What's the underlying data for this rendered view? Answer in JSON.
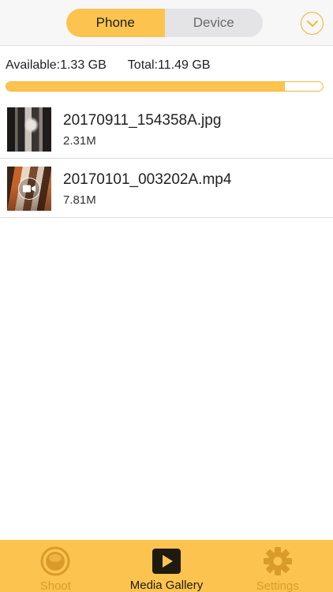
{
  "header": {
    "segments": [
      {
        "label": "Phone",
        "active": true
      },
      {
        "label": "Device",
        "active": false
      }
    ],
    "dropdown_icon": "chevron-down-circle-icon"
  },
  "storage": {
    "available": "Available:1.33 GB",
    "total": "Total:11.49 GB",
    "used_fraction": 0.88
  },
  "files": [
    {
      "name": "20170911_154358A.jpg",
      "size": "2.31M",
      "type": "image"
    },
    {
      "name": "20170101_003202A.mp4",
      "size": "7.81M",
      "type": "video"
    }
  ],
  "tabs": [
    {
      "label": "Shoot",
      "icon": "camera-lens-icon",
      "active": false
    },
    {
      "label": "Media Gallery",
      "icon": "play-icon",
      "active": true
    },
    {
      "label": "Settings",
      "icon": "gear-icon",
      "active": false
    }
  ],
  "colors": {
    "accent": "#fcc44e",
    "accent_dark": "#f5b12c",
    "tab_inactive_text": "#d99b2a"
  }
}
